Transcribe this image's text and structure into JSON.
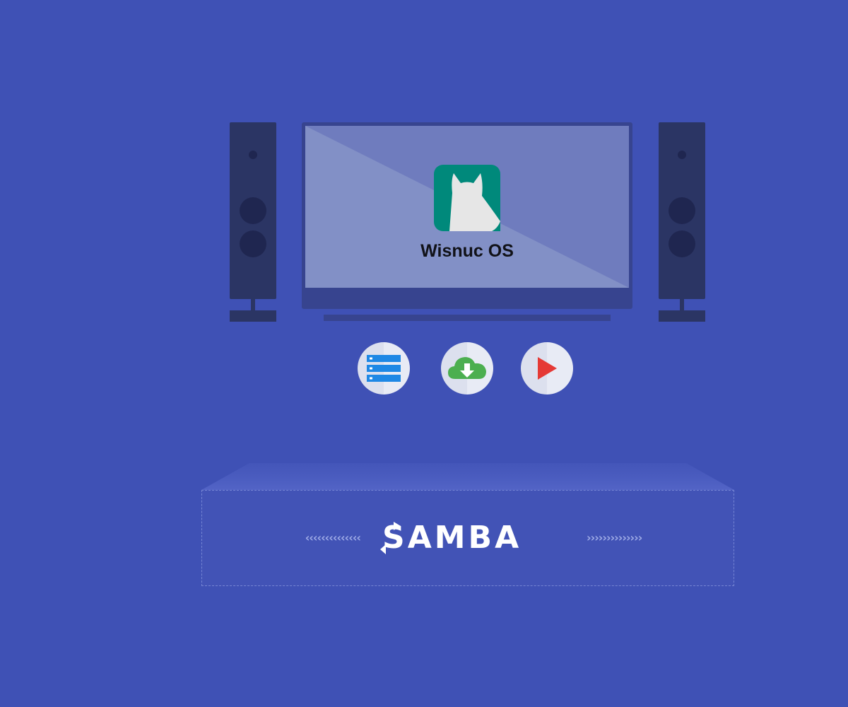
{
  "tv": {
    "app_name": "Wisnuc OS",
    "app_icon": "wisnuc-cat-icon",
    "app_icon_color": "#00897B"
  },
  "action_icons": [
    {
      "icon": "storage-list-icon",
      "color": "#1E88E5"
    },
    {
      "icon": "cloud-download-icon",
      "color": "#4CAF50"
    },
    {
      "icon": "play-icon",
      "color": "#E53935"
    }
  ],
  "samba": {
    "logo_text": "SAMBA",
    "left_chevrons": "‹‹‹‹‹‹‹‹‹‹‹‹‹‹",
    "right_chevrons": "››››››››››››››"
  },
  "colors": {
    "background": "#3F51B5",
    "speaker": "#2B3564",
    "tv_frame": "#37448F",
    "screen": "#8290C6"
  }
}
